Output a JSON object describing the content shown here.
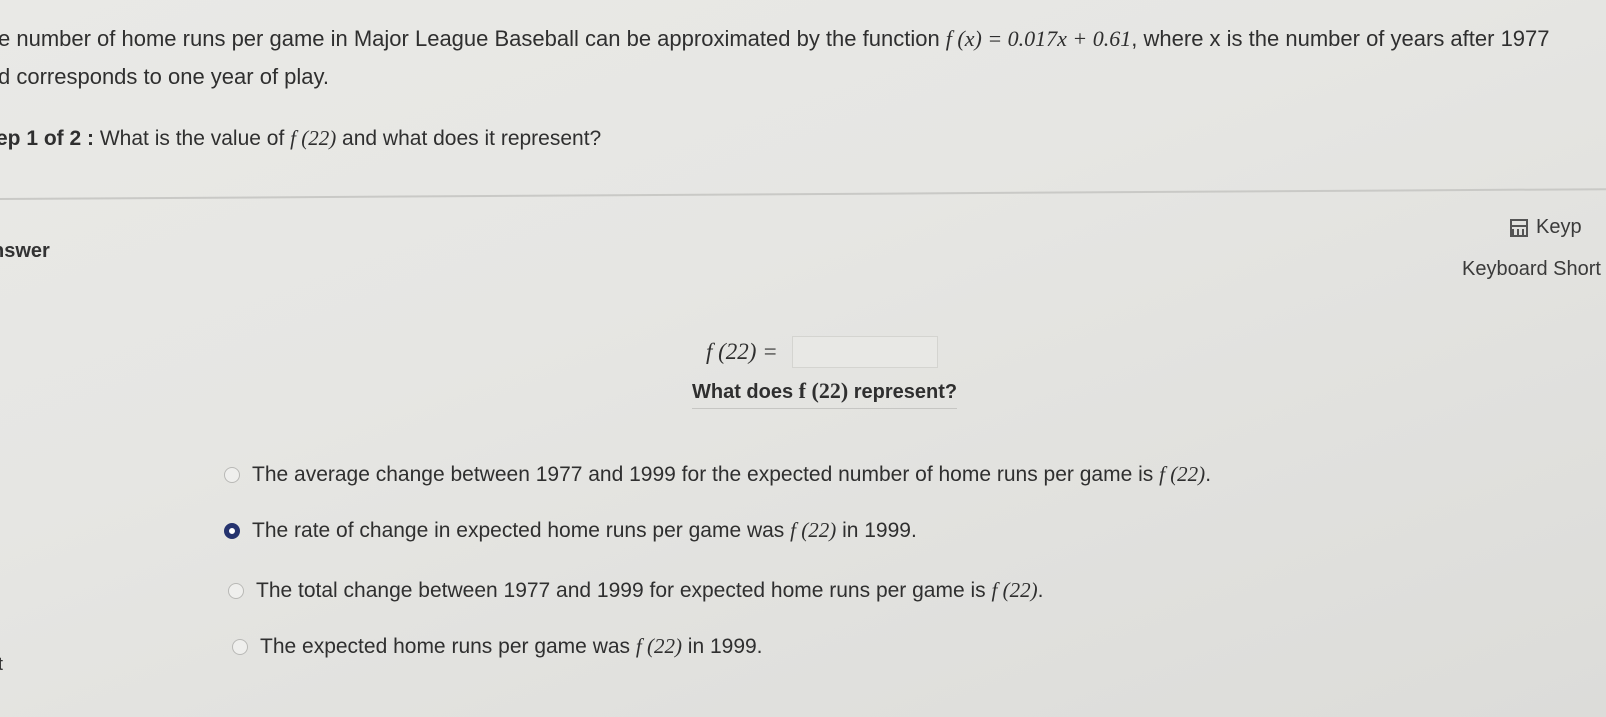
{
  "problem": {
    "line1_prefix": "e number of home runs per game in Major League Baseball can be approximated by the function ",
    "function_expr": "f (x)  =  0.017x + 0.61",
    "line1_suffix": ", where x is the number of years after 1977",
    "line2": "d corresponds to one year of play."
  },
  "step": {
    "label": "ep 1 of 2 :",
    "question_prefix": " What is the value of ",
    "question_func": "f (22)",
    "question_suffix": " and what does it represent?"
  },
  "answer": {
    "label": "nswer",
    "keypad_label": "Keyp",
    "shortcuts_label": "Keyboard Short",
    "f_label": "f (22)  =",
    "f_value": "",
    "represent_prefix": "What does ",
    "represent_func": "f (22)",
    "represent_suffix": " represent?"
  },
  "options": [
    {
      "text": "The average change between 1977 and 1999 for the expected number of home runs per game is ",
      "func": "f (22)",
      "suffix": ".",
      "selected": false
    },
    {
      "text": "The rate of change in expected home runs per game was ",
      "func": "f (22)",
      "suffix": " in 1999.",
      "selected": true
    },
    {
      "text": "The total change between 1977 and 1999 for expected home runs per game is ",
      "func": "f (22)",
      "suffix": ".",
      "selected": false
    },
    {
      "text": "The expected home runs per game was ",
      "func": "f (22)",
      "suffix": " in 1999.",
      "selected": false
    }
  ],
  "corner_mark": "t",
  "colors": {
    "selected_radio": "#25336e",
    "background": "#e6e6e3",
    "text": "#2f2f2f"
  }
}
